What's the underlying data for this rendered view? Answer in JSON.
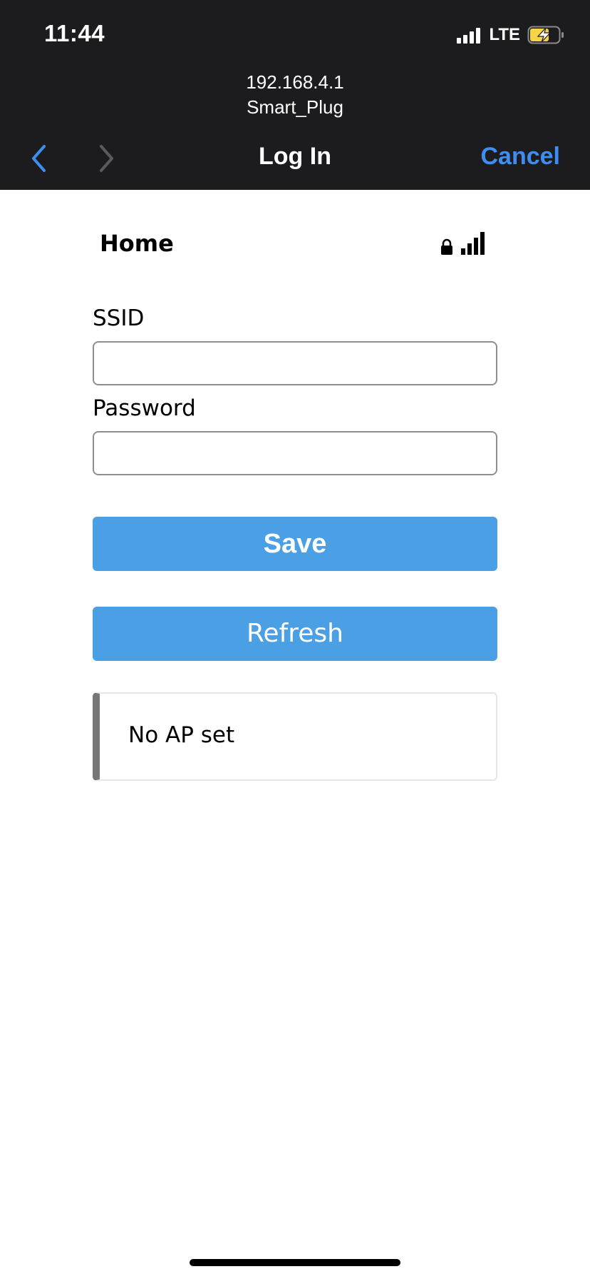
{
  "status_bar": {
    "time": "11:44",
    "network_type": "LTE"
  },
  "browser": {
    "url_host": "192.168.4.1",
    "page_name": "Smart_Plug",
    "title": "Log In",
    "cancel_label": "Cancel"
  },
  "wifi_form": {
    "network_name": "Home",
    "ssid_label": "SSID",
    "ssid_value": "",
    "password_label": "Password",
    "password_value": "",
    "save_label": "Save",
    "refresh_label": "Refresh",
    "status_message": "No AP set"
  },
  "colors": {
    "accent_blue": "#3d8ef0",
    "button_blue": "#4a9fe5",
    "header_bg": "#1c1c1e",
    "battery_charge": "#f5d547"
  }
}
